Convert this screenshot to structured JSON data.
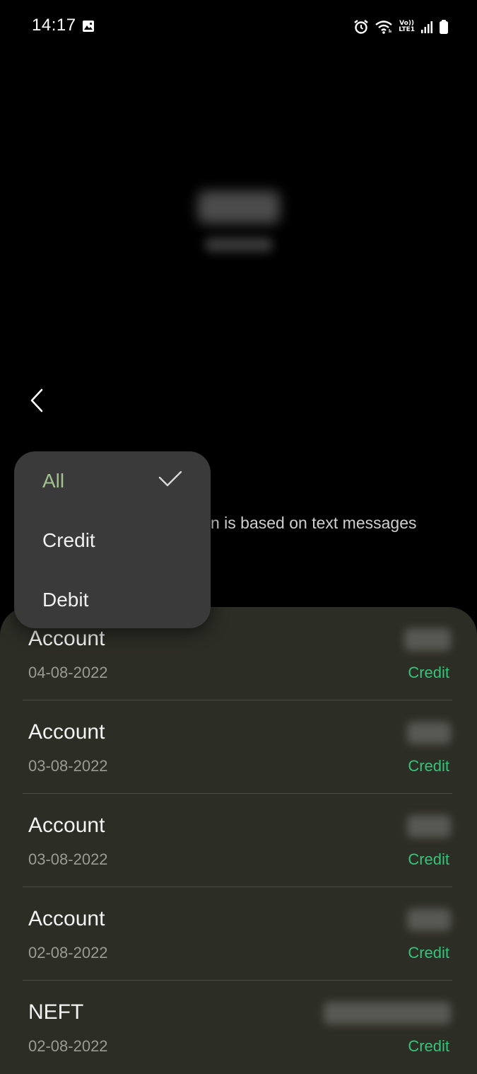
{
  "status_bar": {
    "time": "14:17",
    "icons": [
      "gallery-icon",
      "alarm-icon",
      "wifi-icon",
      "volte-icon",
      "signal-icon",
      "battery-icon"
    ],
    "volte_top": "Vo))",
    "volte_bottom": "LTE1"
  },
  "header": {
    "back_icon": "chevron-left-icon"
  },
  "info_text": "n is based on text messages",
  "filter_menu": {
    "selected": "All",
    "options": [
      {
        "label": "All",
        "selected": true
      },
      {
        "label": "Credit",
        "selected": false
      },
      {
        "label": "Debit",
        "selected": false
      }
    ]
  },
  "transactions": [
    {
      "title": "Account",
      "date": "04-08-2022",
      "type": "Credit"
    },
    {
      "title": "Account",
      "date": "03-08-2022",
      "type": "Credit"
    },
    {
      "title": "Account",
      "date": "03-08-2022",
      "type": "Credit"
    },
    {
      "title": "Account",
      "date": "02-08-2022",
      "type": "Credit"
    },
    {
      "title": "NEFT",
      "date": "02-08-2022",
      "type": "Credit"
    }
  ],
  "colors": {
    "background": "#000000",
    "panel": "#2c2d25",
    "menu": "#3a3a3a",
    "credit": "#35c479",
    "selected_option": "#a3c08f"
  }
}
